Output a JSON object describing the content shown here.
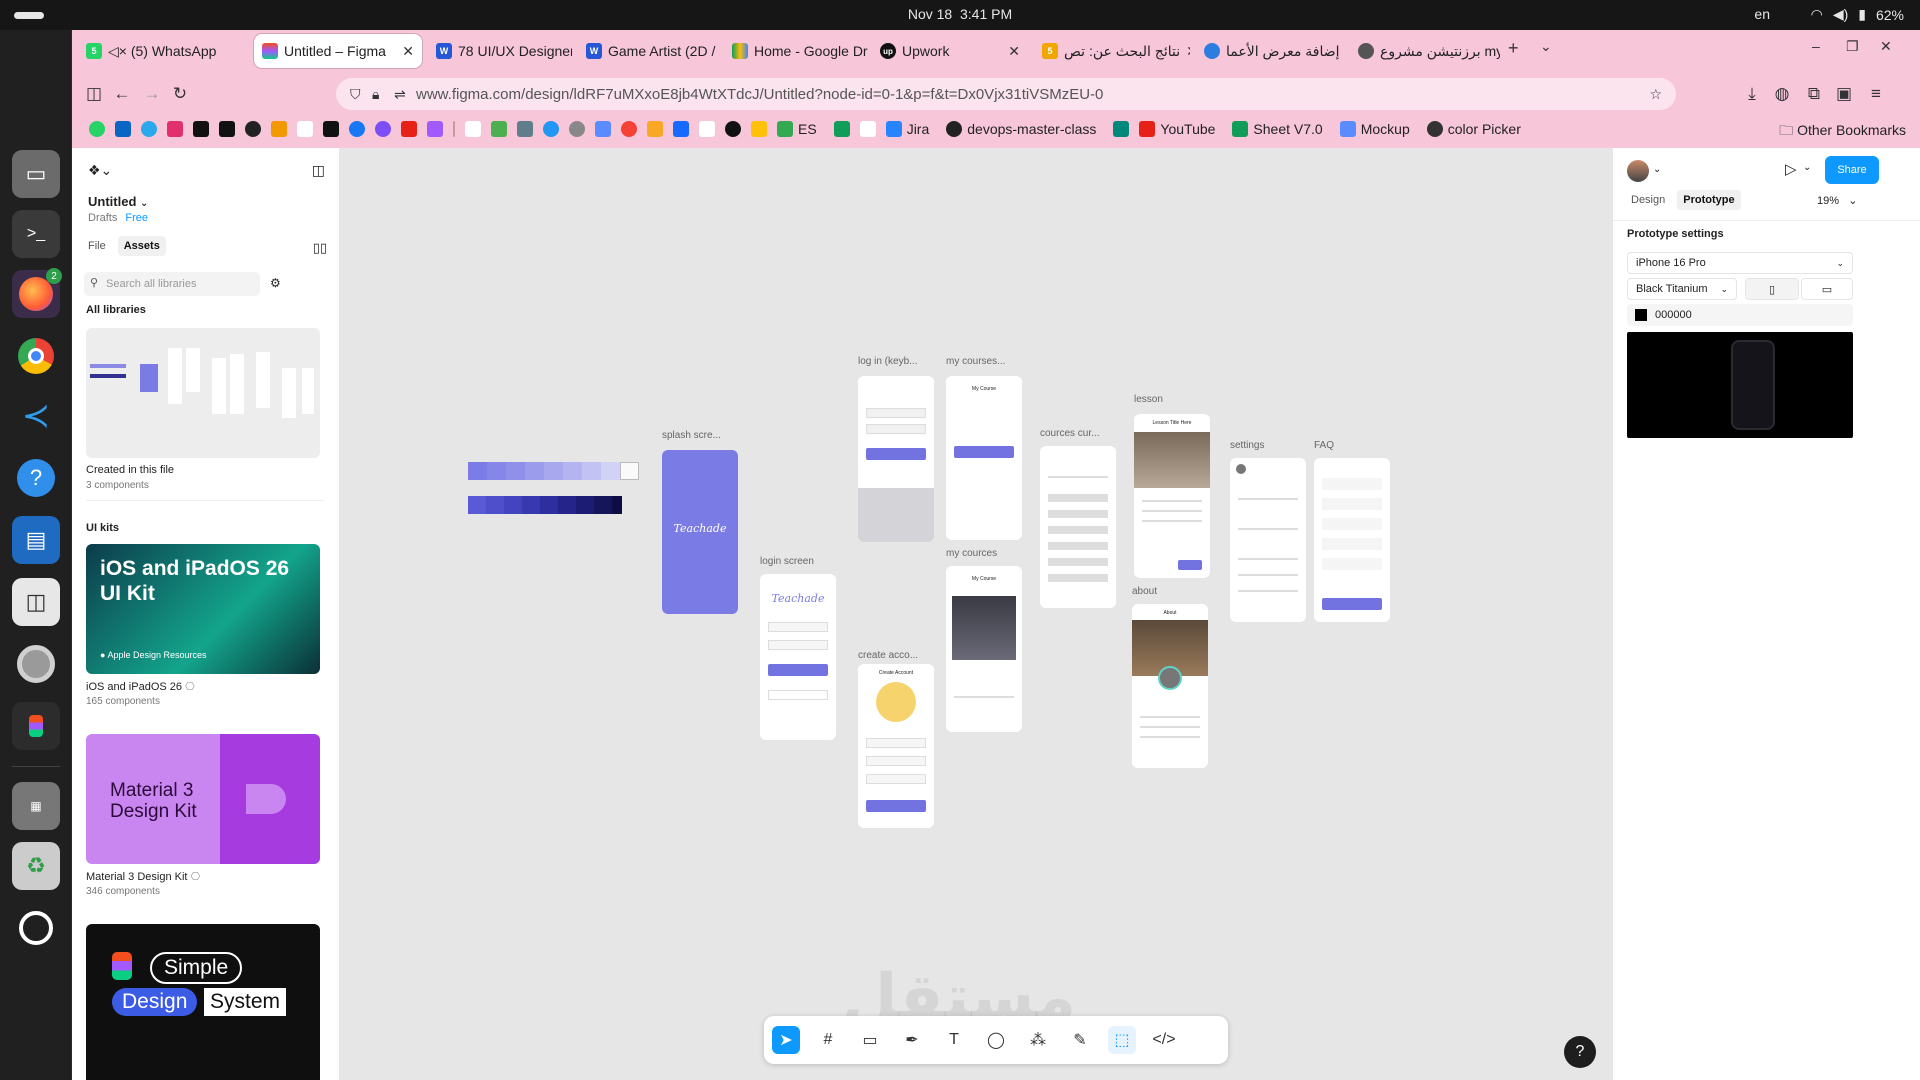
{
  "system": {
    "date": "Nov 18",
    "time": "3:41 PM",
    "lang": "en",
    "battery": "62%"
  },
  "dock": {
    "firefox_badge": "2"
  },
  "tabs": [
    {
      "label": "(5) WhatsApp",
      "icon": "5"
    },
    {
      "label": "Untitled – Figma",
      "active": true
    },
    {
      "label": "78 UI/UX Designer",
      "icon": "W"
    },
    {
      "label": "Game Artist (2D / 3",
      "icon": "W"
    },
    {
      "label": "Home - Google Dri"
    },
    {
      "label": "Upwork",
      "icon": "up"
    },
    {
      "label": "نتائج البحث عن: تص",
      "icon": "5"
    },
    {
      "label": "إضافة معرض الأعما"
    },
    {
      "label": "برزنتيشن مشروع my"
    }
  ],
  "address": {
    "url": "www.figma.com/design/ldRF7uMXxoE8jb4WtXTdcJ/Untitled?node-id=0-1&p=f&t=Dx0Vjx31tiVSMzEU-0"
  },
  "bookmarks": [
    {
      "label": "ES"
    },
    {
      "label": "Jira"
    },
    {
      "label": "devops-master-class"
    },
    {
      "label": "YouTube"
    },
    {
      "label": "Sheet V7.0"
    },
    {
      "label": "Mockup"
    },
    {
      "label": "color Picker"
    }
  ],
  "other_bookmarks": "Other Bookmarks",
  "left": {
    "file_title": "Untitled",
    "drafts": "Drafts",
    "plan": "Free",
    "tab_file": "File",
    "tab_assets": "Assets",
    "search_placeholder": "Search all libraries",
    "all_libraries": "All libraries",
    "created_title": "Created in this file",
    "created_count": "3 components",
    "ui_kits": "UI kits",
    "kit1_cover": "iOS and iPadOS 26 UI Kit",
    "kit1_brand": "Apple Design Resources",
    "kit1_name": "iOS and iPadOS 26",
    "kit1_count": "165 components",
    "kit2_cover": "Material 3 Design Kit",
    "kit2_name": "Material 3 Design Kit",
    "kit2_count": "346 components",
    "kit3_word1": "Simple",
    "kit3_word2": "Design",
    "kit3_word3": "System"
  },
  "canvas": {
    "frames": {
      "splash": "splash scre...",
      "login": "login  screen",
      "login_kb": "log in (keyb...",
      "create": "create acco...",
      "mycourses1": "my courses...",
      "mycourses2": "my cources",
      "courses_cur": "cources cur...",
      "lesson": "lesson",
      "about": "about",
      "settings": "settings",
      "faq": "FAQ"
    },
    "brand": "Teachade",
    "ui_login": "Log in",
    "ui_create": "Create Account",
    "ui_mycourse": "My Course",
    "ui_about": "About",
    "ui_lesson": "Lesson Title Here"
  },
  "right": {
    "share": "Share",
    "tab_design": "Design",
    "tab_prototype": "Prototype",
    "zoom": "19%",
    "proto_settings": "Prototype settings",
    "device": "iPhone 16 Pro",
    "color_model": "Black Titanium",
    "bg_hex": "000000"
  },
  "watermark": "مستقل"
}
